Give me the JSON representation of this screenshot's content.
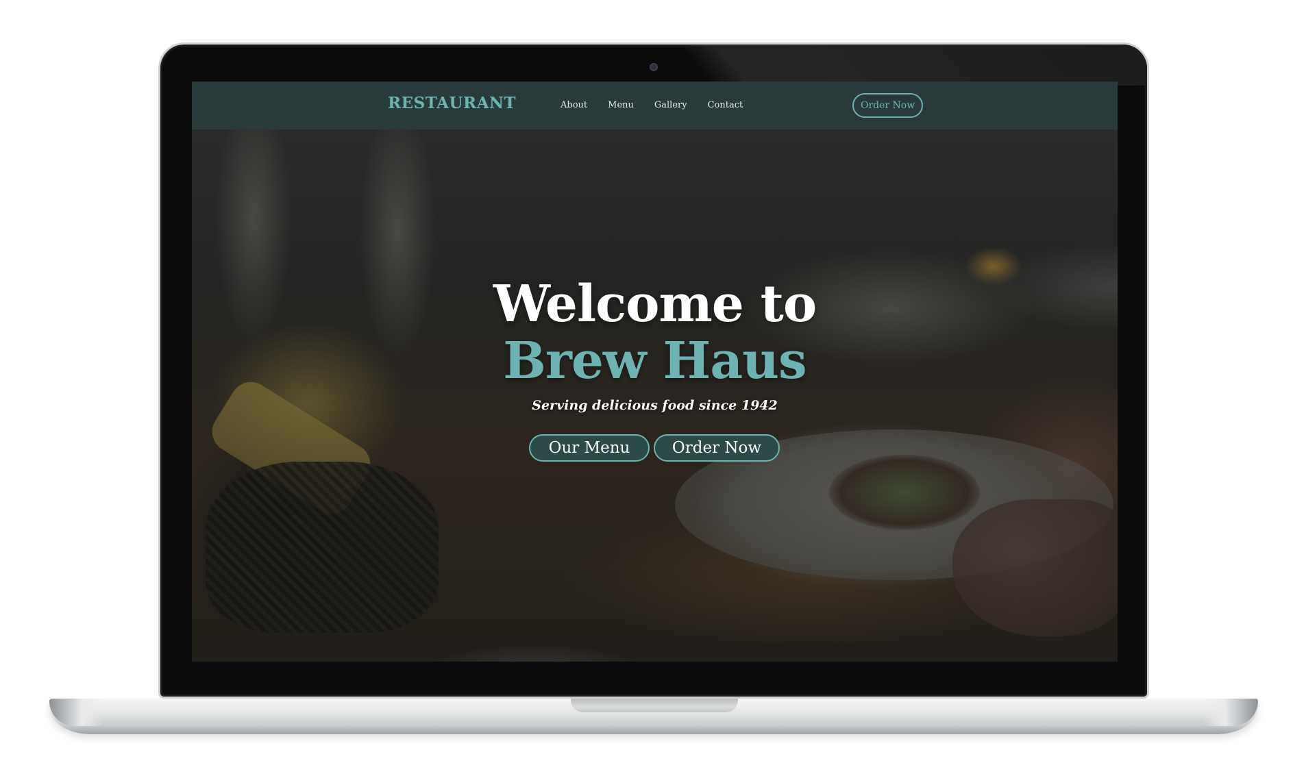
{
  "nav": {
    "brand": "RESTAURANT",
    "links": [
      "About",
      "Menu",
      "Gallery",
      "Contact"
    ],
    "order_button": "Order Now"
  },
  "hero": {
    "title_line_1": "Welcome to",
    "title_line_2": "Brew Haus",
    "tagline": "Serving delicious food since 1942",
    "buttons": {
      "menu": "Our Menu",
      "order": "Order Now"
    }
  },
  "colors": {
    "accent": "#6eb3b3",
    "navbar_bg": "#283e3c",
    "button_bg": "#2c4a47",
    "text_light": "#ffffff"
  },
  "icons": {
    "camera": "webcam-icon"
  }
}
